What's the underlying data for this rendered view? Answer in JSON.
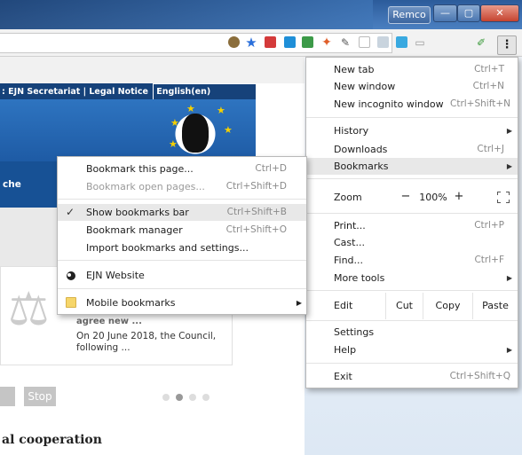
{
  "window": {
    "profile_name": "Remco",
    "minimize_glyph": "—",
    "maximize_glyph": "▢",
    "close_glyph": "✕"
  },
  "toolbar": {
    "icons": [
      "extension-icon",
      "bookmark-star-icon",
      "extension-red-icon",
      "extension-blue-icon",
      "extension-beta-icon",
      "extension-pinwheel-icon",
      "eyedropper-icon",
      "blank-page-icon",
      "tc-icon",
      "screen-icon",
      "cast-icon",
      "pen-icon"
    ],
    "menu_glyph": "⋮"
  },
  "page": {
    "banner_nav": ": EJN Secretariat | Legal Notice",
    "language": "English(en)",
    "banner_word": "che",
    "news_title": "agree new ...",
    "news_body": "On 20 June 2018, the Council, following ...",
    "stop_label": "Stop",
    "section_heading": "al cooperation"
  },
  "main_menu": {
    "new_tab": {
      "label": "New tab",
      "shortcut": "Ctrl+T"
    },
    "new_window": {
      "label": "New window",
      "shortcut": "Ctrl+N"
    },
    "incognito": {
      "label": "New incognito window",
      "shortcut": "Ctrl+Shift+N"
    },
    "history": {
      "label": "History"
    },
    "downloads": {
      "label": "Downloads",
      "shortcut": "Ctrl+J"
    },
    "bookmarks": {
      "label": "Bookmarks"
    },
    "zoom": {
      "label": "Zoom",
      "minus": "−",
      "value": "100%",
      "plus": "+"
    },
    "print": {
      "label": "Print...",
      "shortcut": "Ctrl+P"
    },
    "cast": {
      "label": "Cast..."
    },
    "find": {
      "label": "Find...",
      "shortcut": "Ctrl+F"
    },
    "more_tools": {
      "label": "More tools"
    },
    "edit": {
      "label": "Edit",
      "cut": "Cut",
      "copy": "Copy",
      "paste": "Paste"
    },
    "settings": {
      "label": "Settings"
    },
    "help": {
      "label": "Help"
    },
    "exit": {
      "label": "Exit",
      "shortcut": "Ctrl+Shift+Q"
    }
  },
  "bookmarks_menu": {
    "bookmark_page": {
      "label": "Bookmark this page...",
      "shortcut": "Ctrl+D"
    },
    "bookmark_open": {
      "label": "Bookmark open pages...",
      "shortcut": "Ctrl+Shift+D"
    },
    "show_bar": {
      "label": "Show bookmarks bar",
      "shortcut": "Ctrl+Shift+B",
      "check": "✓"
    },
    "manager": {
      "label": "Bookmark manager",
      "shortcut": "Ctrl+Shift+O"
    },
    "import": {
      "label": "Import bookmarks and settings..."
    },
    "ejn": {
      "label": "EJN Website"
    },
    "mobile": {
      "label": "Mobile bookmarks"
    }
  }
}
